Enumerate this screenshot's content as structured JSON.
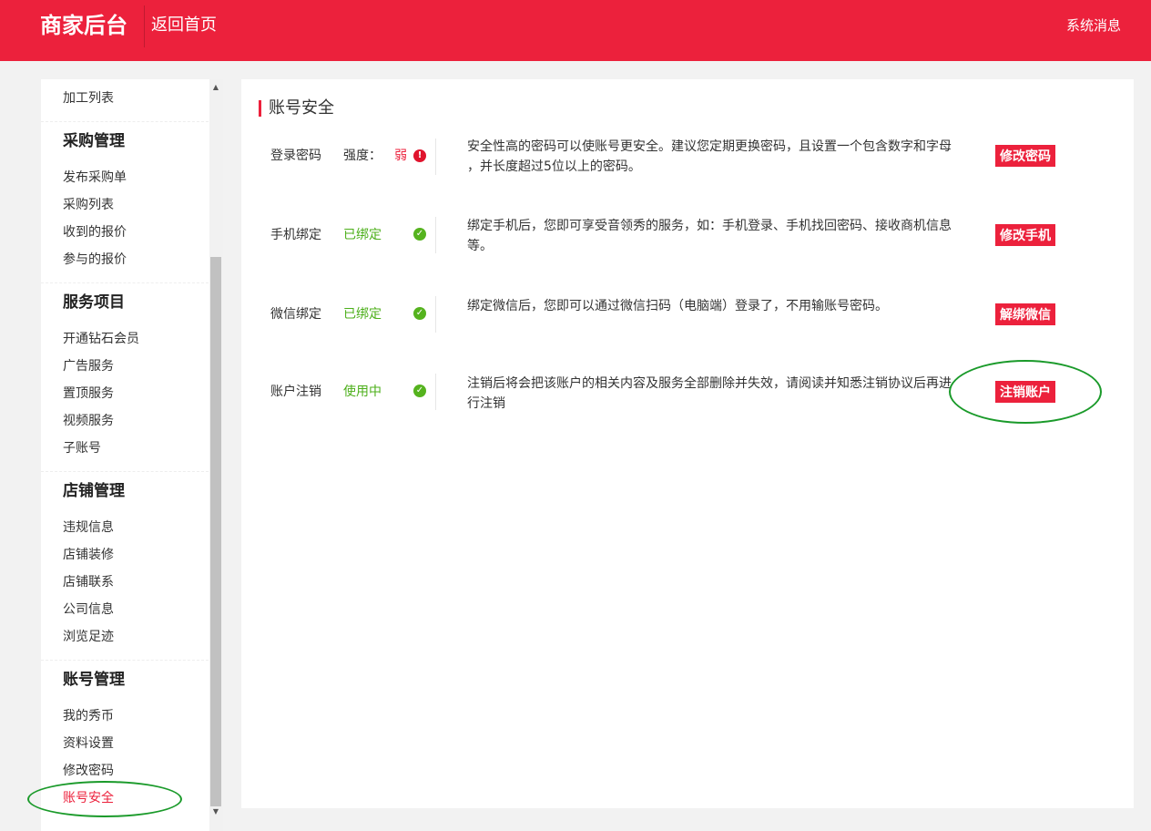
{
  "header": {
    "brand": "商家后台",
    "home_link": "返回首页",
    "system_messages": "系统消息"
  },
  "sidebar": {
    "top_item": "加工列表",
    "groups": [
      {
        "title": "采购管理",
        "items": [
          "发布采购单",
          "采购列表",
          "收到的报价",
          "参与的报价"
        ]
      },
      {
        "title": "服务项目",
        "items": [
          "开通钻石会员",
          "广告服务",
          "置顶服务",
          "视频服务",
          "子账号"
        ]
      },
      {
        "title": "店铺管理",
        "items": [
          "违规信息",
          "店铺装修",
          "店铺联系",
          "公司信息",
          "浏览足迹"
        ]
      },
      {
        "title": "账号管理",
        "items": [
          "我的秀币",
          "资料设置",
          "修改密码",
          "账号安全"
        ]
      }
    ],
    "active_item": "账号安全"
  },
  "main": {
    "title": "账号安全",
    "rows": [
      {
        "label": "登录密码",
        "status_prefix": "强度：",
        "status": "弱",
        "status_color": "#ec213c",
        "status_icon": "exclamation-icon",
        "description": "安全性高的密码可以使账号更安全。建议您定期更换密码，且设置一个包含数字和字母 ，并长度超过5位以上的密码。",
        "action": "修改密码"
      },
      {
        "label": "手机绑定",
        "status": "已绑定",
        "status_color": "#4caf1a",
        "status_icon": "check-icon",
        "description": "绑定手机后，您即可享受音领秀的服务，如：手机登录、手机找回密码、接收商机信息 等。",
        "action": "修改手机"
      },
      {
        "label": "微信绑定",
        "status": "已绑定",
        "status_color": "#4caf1a",
        "status_icon": "check-icon",
        "description": "绑定微信后，您即可以通过微信扫码（电脑端）登录了，不用输账号密码。",
        "action": "解绑微信"
      },
      {
        "label": "账户注销",
        "status": "使用中",
        "status_color": "#4caf1a",
        "status_icon": "check-icon",
        "description": "注销后将会把该账户的相关内容及服务全部删除并失效，请阅读并知悉注销协议后再进行注销",
        "action": "注销账户"
      }
    ]
  },
  "colors": {
    "brand_red": "#ec213c",
    "ok_green": "#4caf1a",
    "highlight_green": "#1a9a2a"
  }
}
